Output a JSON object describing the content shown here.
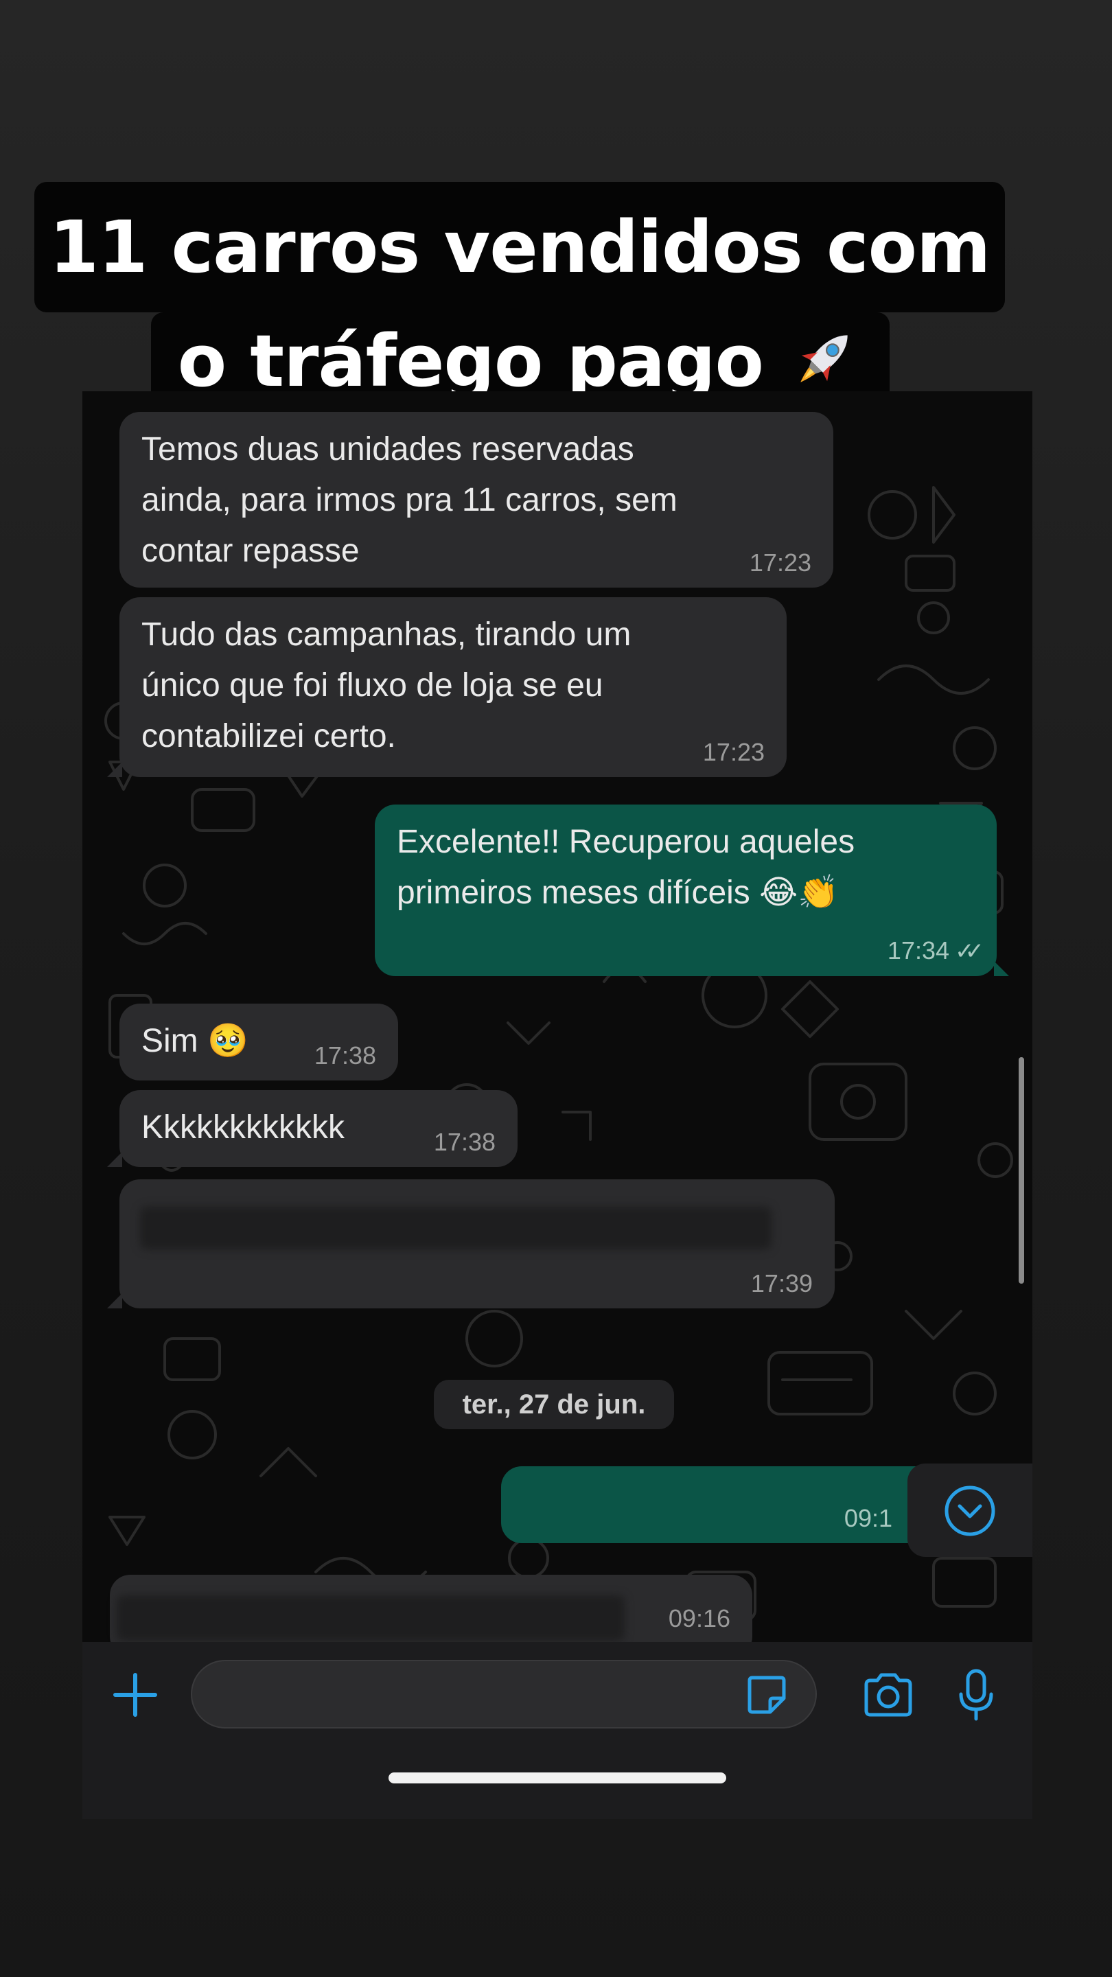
{
  "caption": {
    "line1": "11 carros vendidos com",
    "line2": "o tráfego pago",
    "emoji": "rocket-icon"
  },
  "messages": [
    {
      "dir": "in",
      "text": "Temos duas unidades reservadas\nainda, para irmos pra 11 carros, sem\ncontar repasse",
      "time": "17:23"
    },
    {
      "dir": "in",
      "text": "Tudo das campanhas, tirando um\núnico que foi fluxo de loja se eu\ncontabilizei certo.",
      "time": "17:23"
    },
    {
      "dir": "out",
      "text": "Excelente!! Recuperou aqueles\nprimeiros meses difíceis 😂👏",
      "time": "17:34"
    },
    {
      "dir": "in",
      "text": "Sim 🥹",
      "time": "17:38"
    },
    {
      "dir": "in",
      "text": "Kkkkkkkkkkkk",
      "time": "17:38"
    },
    {
      "dir": "in",
      "text": "",
      "time": "17:39"
    },
    {
      "dir": "out",
      "text": "",
      "time": "09:1"
    },
    {
      "dir": "in",
      "text": "",
      "time": "09:16"
    }
  ],
  "date_separator": "ter., 27 de jun.",
  "input": {
    "value": "",
    "placeholder": ""
  },
  "colors": {
    "incoming_bubble": "#2b2b2d",
    "outgoing_bubble": "#0b5547",
    "accent_blue": "#2aa0e6",
    "wallpaper": "#0b0b0b"
  },
  "icons": [
    "plus-icon",
    "sticker-icon",
    "camera-icon",
    "microphone-icon",
    "chevron-down-icon",
    "double-check-icon"
  ]
}
